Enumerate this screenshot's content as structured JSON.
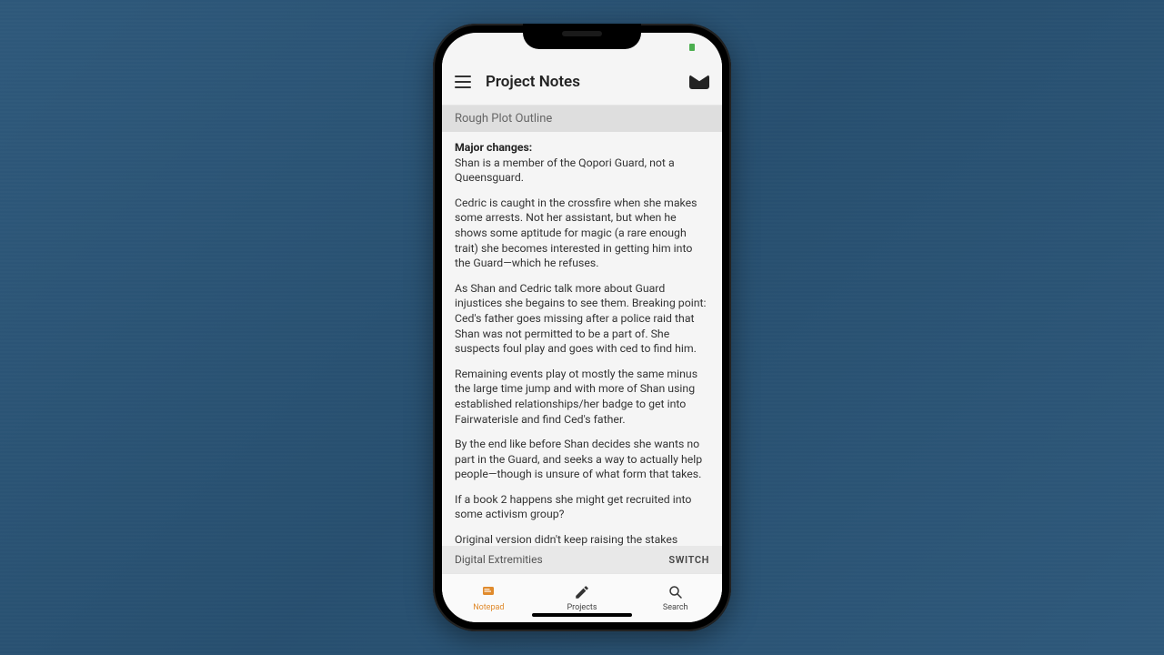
{
  "header": {
    "title": "Project Notes"
  },
  "section": {
    "title": "Rough Plot Outline"
  },
  "note": {
    "lead_label": "Major changes:",
    "p1": "Shan is a member of the Qopori Guard, not a Queensguard.",
    "p2": "Cedric is caught in the crossfire when she makes some arrests. Not her assistant, but when he shows some aptitude for magic (a rare enough trait) she becomes interested in getting him into the Guard—which he refuses.",
    "p3": "As Shan and Cedric talk more about Guard injustices she begains to see them. Breaking point: Ced's father goes missing after a police raid that Shan was not permitted to be a part of. She suspects foul play and goes with ced to find him.",
    "p4": "Remaining events play ot mostly the same minus the large time jump and with more of Shan using established relationships/her badge to get into Fairwaterisle and find Ced's father.",
    "p5": "By the end like before Shan decides she wants no part in the Guard, and seeks a way to actually help people—though is unsure of what form that takes.",
    "p6": "If a book 2 happens she might get recruited into some activism group?",
    "p7": "Original version didn't keep raising the stakes enough."
  },
  "project_bar": {
    "name": "Digital Extremities",
    "switch_label": "SWITCH"
  },
  "tabs": {
    "notepad": "Notepad",
    "projects": "Projects",
    "search": "Search"
  },
  "colors": {
    "accent": "#e08a2c",
    "background": "#2a5578"
  }
}
